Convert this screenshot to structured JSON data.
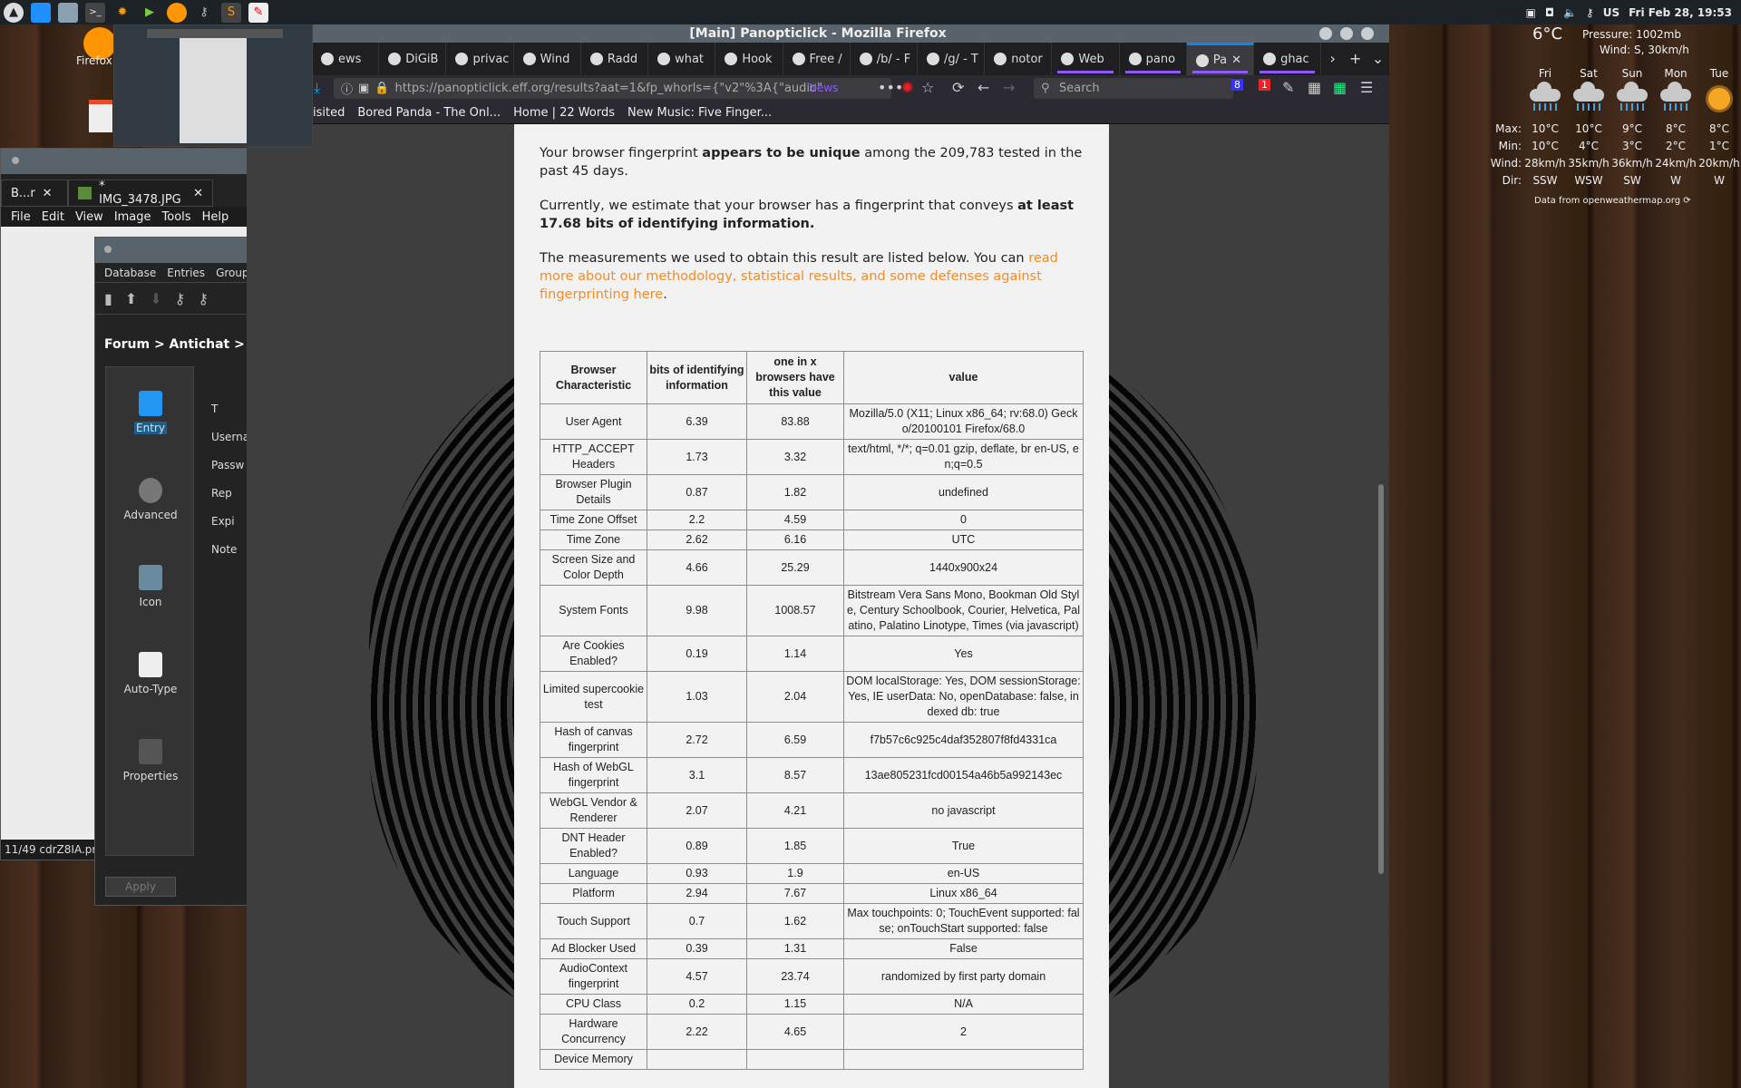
{
  "panel": {
    "icons": [
      "arch-logo-icon",
      "desktop-icon",
      "files-icon",
      "terminal-icon",
      "gear-app-icon",
      "play-icon",
      "firefox-icon",
      "keys-icon",
      "sublime-icon",
      "document-icon"
    ],
    "layout": "US",
    "clock": "Fri Feb 28, 19:53"
  },
  "desktop": {
    "firefox_label": "Firefox"
  },
  "weather": {
    "now": "6°C",
    "pressure": "Pressure: 1002mb",
    "wind": "Wind: S, 30km/h",
    "row_labels": {
      "max": "Max:",
      "min": "Min:",
      "wind": "Wind:",
      "dir": "Dir:"
    },
    "days": [
      {
        "day": "Fri",
        "icon": "rain",
        "max": "10°C",
        "min": "10°C",
        "wind": "28km/h",
        "dir": "SSW"
      },
      {
        "day": "Sat",
        "icon": "rain",
        "max": "10°C",
        "min": "4°C",
        "wind": "35km/h",
        "dir": "WSW"
      },
      {
        "day": "Sun",
        "icon": "rain",
        "max": "9°C",
        "min": "3°C",
        "wind": "36km/h",
        "dir": "SW"
      },
      {
        "day": "Mon",
        "icon": "rain",
        "max": "8°C",
        "min": "2°C",
        "wind": "24km/h",
        "dir": "W"
      },
      {
        "day": "Tue",
        "icon": "sun",
        "max": "8°C",
        "min": "1°C",
        "wind": "20km/h",
        "dir": "W"
      }
    ],
    "source": "Data from openweathermap.org"
  },
  "image_viewer": {
    "tabs": [
      "B...r",
      "* IMG_3478.JPG"
    ],
    "menu": [
      "File",
      "Edit",
      "View",
      "Image",
      "Tools",
      "Help"
    ],
    "status": "11/49  cdrZ8IA.pr"
  },
  "keepass": {
    "menu": [
      "Database",
      "Entries",
      "Groups"
    ],
    "breadcrumb": "Forum > Antichat > E",
    "sections": [
      "Entry",
      "Advanced",
      "Icon",
      "Auto-Type",
      "Properties"
    ],
    "fields": [
      "T",
      "Userna",
      "Passw",
      "Rep",
      "",
      "Expi",
      "Note"
    ],
    "apply": "Apply"
  },
  "firefox": {
    "title": "[Main] Panopticlick - Mozilla Firefox",
    "tabs": [
      "ews",
      "DiGiB",
      "privac",
      "Wind",
      "Radd",
      "what",
      "Hook",
      "Free /",
      "/b/ - F",
      "/g/ - T",
      "notor",
      "Web",
      "pano",
      "Pa",
      "ghac"
    ],
    "active_tab": 13,
    "url": "https://panopticlick.eff.org/results?aat=1&fp_whorls={\"v2\"%3A{\"audio\"",
    "news_label": "News",
    "search_placeholder": "Search",
    "badges": [
      "8",
      "1"
    ],
    "bookmarks": [
      "isited",
      "Bored Panda - The Onl...",
      "Home | 22 Words",
      "New Music: Five Finger..."
    ]
  },
  "page": {
    "p1": {
      "pre": "Your browser fingerprint ",
      "bold": "appears to be unique",
      "post": " among the 209,783 tested in the past 45 days."
    },
    "p2": {
      "pre": "Currently, we estimate that your browser has a fingerprint that conveys ",
      "bold": "at least 17.68 bits of identifying information."
    },
    "p3": {
      "pre": "The measurements we used to obtain this result are listed below. You can ",
      "link": "read more about our methodology, statistical results, and some defenses against fingerprinting here",
      "post": "."
    },
    "accent": "#f28c28",
    "table": {
      "headers": [
        "Browser Characteristic",
        "bits of identifying information",
        "one in x browsers have this value",
        "value"
      ],
      "rows": [
        [
          "User Agent",
          "6.39",
          "83.88",
          "Mozilla/5.0 (X11; Linux x86_64; rv:68.0) Gecko/20100101 Firefox/68.0"
        ],
        [
          "HTTP_ACCEPT Headers",
          "1.73",
          "3.32",
          "text/html, */*; q=0.01 gzip, deflate, br en-US, en;q=0.5"
        ],
        [
          "Browser Plugin Details",
          "0.87",
          "1.82",
          "undefined"
        ],
        [
          "Time Zone Offset",
          "2.2",
          "4.59",
          "0"
        ],
        [
          "Time Zone",
          "2.62",
          "6.16",
          "UTC"
        ],
        [
          "Screen Size and Color Depth",
          "4.66",
          "25.29",
          "1440x900x24"
        ],
        [
          "System Fonts",
          "9.98",
          "1008.57",
          "Bitstream Vera Sans Mono, Bookman Old Style, Century Schoolbook, Courier, Helvetica, Palatino, Palatino Linotype, Times (via javascript)"
        ],
        [
          "Are Cookies Enabled?",
          "0.19",
          "1.14",
          "Yes"
        ],
        [
          "Limited supercookie test",
          "1.03",
          "2.04",
          "DOM localStorage: Yes, DOM sessionStorage: Yes, IE userData: No, openDatabase: false, indexed db: true"
        ],
        [
          "Hash of canvas fingerprint",
          "2.72",
          "6.59",
          "f7b57c6c925c4daf352807f8fd4331ca"
        ],
        [
          "Hash of WebGL fingerprint",
          "3.1",
          "8.57",
          "13ae805231fcd00154a46b5a992143ec"
        ],
        [
          "WebGL Vendor & Renderer",
          "2.07",
          "4.21",
          "no javascript"
        ],
        [
          "DNT Header Enabled?",
          "0.89",
          "1.85",
          "True"
        ],
        [
          "Language",
          "0.93",
          "1.9",
          "en-US"
        ],
        [
          "Platform",
          "2.94",
          "7.67",
          "Linux x86_64"
        ],
        [
          "Touch Support",
          "0.7",
          "1.62",
          "Max touchpoints: 0; TouchEvent supported: false; onTouchStart supported: false"
        ],
        [
          "Ad Blocker Used",
          "0.39",
          "1.31",
          "False"
        ],
        [
          "AudioContext fingerprint",
          "4.57",
          "23.74",
          "randomized by first party domain"
        ],
        [
          "CPU Class",
          "0.2",
          "1.15",
          "N/A"
        ],
        [
          "Hardware Concurrency",
          "2.22",
          "4.65",
          "2"
        ],
        [
          "Device Memory",
          "",
          "",
          ""
        ]
      ]
    }
  }
}
